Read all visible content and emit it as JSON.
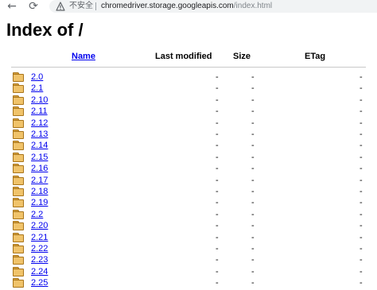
{
  "browser": {
    "not_secure_label": "不安全",
    "url_host": "chromedriver.storage.googleapis.com",
    "url_path": "/index.html"
  },
  "page": {
    "title": "Index of /",
    "columns": {
      "name": "Name",
      "last_modified": "Last modified",
      "size": "Size",
      "etag": "ETag"
    },
    "rows": [
      {
        "name": "2.0",
        "last_modified": "-",
        "size": "-",
        "etag": "-"
      },
      {
        "name": "2.1",
        "last_modified": "-",
        "size": "-",
        "etag": "-"
      },
      {
        "name": "2.10",
        "last_modified": "-",
        "size": "-",
        "etag": "-"
      },
      {
        "name": "2.11",
        "last_modified": "-",
        "size": "-",
        "etag": "-"
      },
      {
        "name": "2.12",
        "last_modified": "-",
        "size": "-",
        "etag": "-"
      },
      {
        "name": "2.13",
        "last_modified": "-",
        "size": "-",
        "etag": "-"
      },
      {
        "name": "2.14",
        "last_modified": "-",
        "size": "-",
        "etag": "-"
      },
      {
        "name": "2.15",
        "last_modified": "-",
        "size": "-",
        "etag": "-"
      },
      {
        "name": "2.16",
        "last_modified": "-",
        "size": "-",
        "etag": "-"
      },
      {
        "name": "2.17",
        "last_modified": "-",
        "size": "-",
        "etag": "-"
      },
      {
        "name": "2.18",
        "last_modified": "-",
        "size": "-",
        "etag": "-"
      },
      {
        "name": "2.19",
        "last_modified": "-",
        "size": "-",
        "etag": "-"
      },
      {
        "name": "2.2",
        "last_modified": "-",
        "size": "-",
        "etag": "-"
      },
      {
        "name": "2.20",
        "last_modified": "-",
        "size": "-",
        "etag": "-"
      },
      {
        "name": "2.21",
        "last_modified": "-",
        "size": "-",
        "etag": "-"
      },
      {
        "name": "2.22",
        "last_modified": "-",
        "size": "-",
        "etag": "-"
      },
      {
        "name": "2.23",
        "last_modified": "-",
        "size": "-",
        "etag": "-"
      },
      {
        "name": "2.24",
        "last_modified": "-",
        "size": "-",
        "etag": "-"
      },
      {
        "name": "2.25",
        "last_modified": "-",
        "size": "-",
        "etag": "-"
      }
    ]
  },
  "icons": {
    "back": "back-arrow-icon",
    "reload": "reload-icon",
    "warning": "warning-icon",
    "folder": "folder-icon"
  },
  "colors": {
    "link": "#0000ee",
    "folder": "#f0c36a"
  }
}
